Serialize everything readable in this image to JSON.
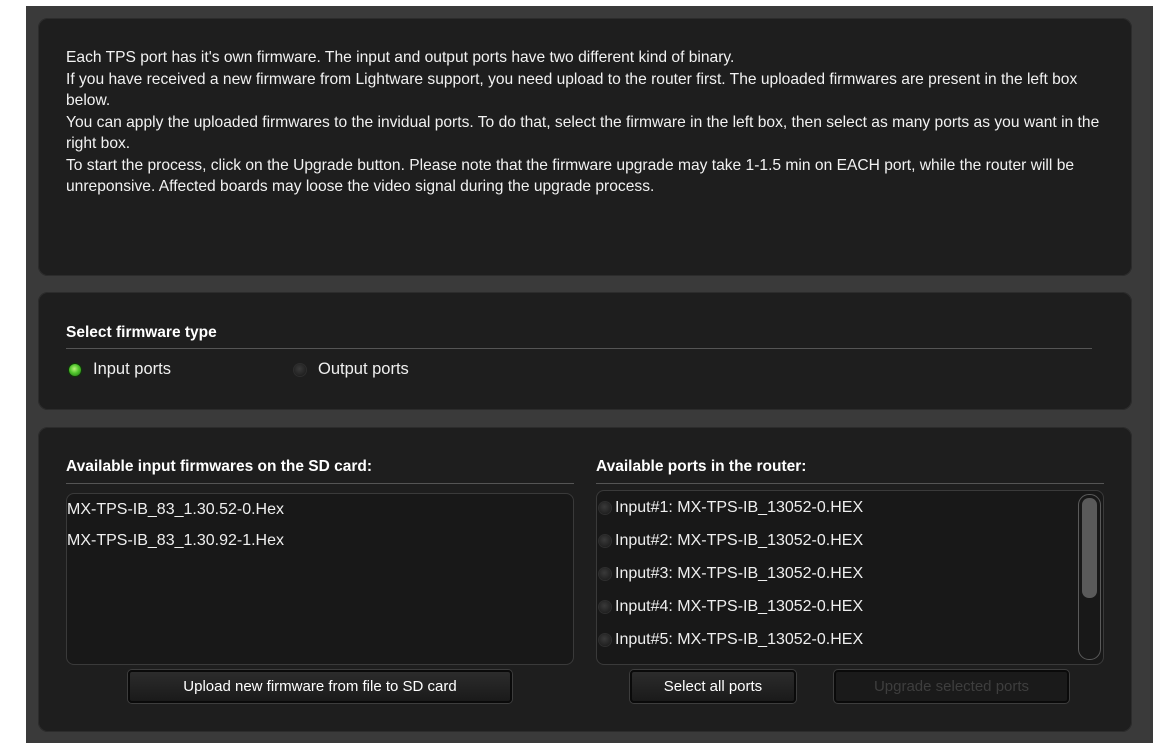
{
  "info": {
    "lines": [
      "Each TPS port has it's own firmware. The input and output ports have two different kind of binary.",
      "If you have received a new firmware from Lightware support, you need upload to the router first. The uploaded firmwares are present in the left box below.",
      "You can apply the uploaded firmwares to the invidual ports. To do that, select the firmware in the left box, then select as many ports as you want in the right box.",
      "To start the process, click on the Upgrade button. Please note that the firmware upgrade may take 1-1.5 min on EACH port, while the router will be unreponsive. Affected boards may loose the video signal during the upgrade process."
    ]
  },
  "firmware_type": {
    "title": "Select firmware type",
    "options": [
      {
        "label": "Input ports",
        "selected": true
      },
      {
        "label": "Output ports",
        "selected": false
      }
    ]
  },
  "firmwares": {
    "title": "Available input firmwares on the SD card:",
    "items": [
      "MX-TPS-IB_83_1.30.52-0.Hex",
      "MX-TPS-IB_83_1.30.92-1.Hex"
    ],
    "upload_button": "Upload new firmware from file to SD card"
  },
  "ports": {
    "title": "Available ports in the router:",
    "items": [
      "Input#1: MX-TPS-IB_13052-0.HEX",
      "Input#2: MX-TPS-IB_13052-0.HEX",
      "Input#3: MX-TPS-IB_13052-0.HEX",
      "Input#4: MX-TPS-IB_13052-0.HEX",
      "Input#5: MX-TPS-IB_13052-0.HEX"
    ],
    "select_all_button": "Select all ports",
    "upgrade_button": "Upgrade selected ports",
    "upgrade_enabled": false
  },
  "colors": {
    "panel": "#1e1e1e",
    "frame": "#3a3a3a",
    "radio_on": "#4fc52c"
  }
}
